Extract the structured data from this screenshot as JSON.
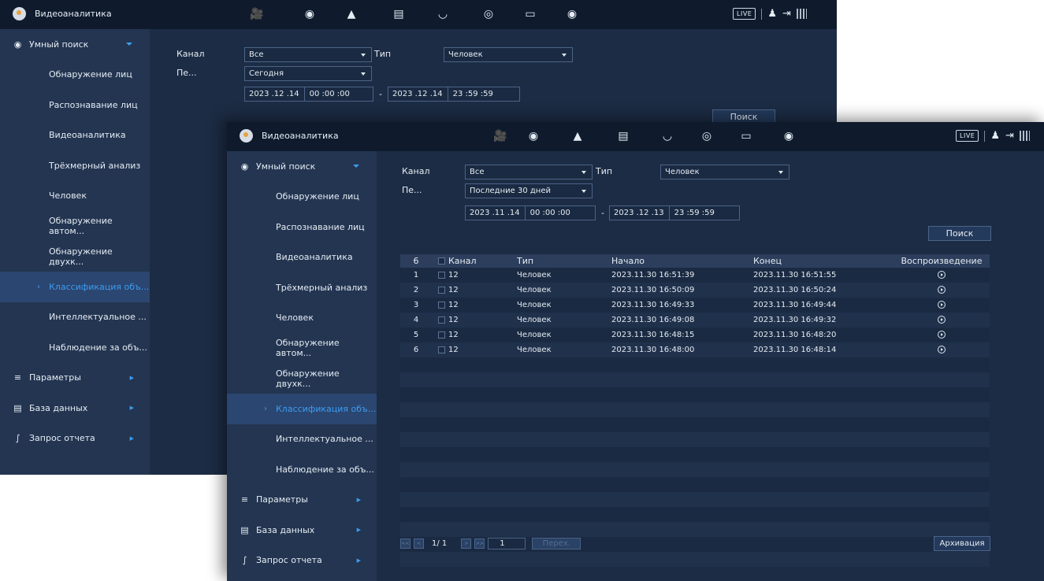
{
  "app": {
    "title": "Видеоаналитика",
    "live_badge": "LIVE",
    "toolbar_icons": [
      "film-icon",
      "face-icon",
      "alarm-icon",
      "storage-icon",
      "speed-icon",
      "target-icon",
      "monitor-icon",
      "speaker-icon"
    ],
    "accent_color": "#3c9cf0"
  },
  "sidebar": {
    "smart_search": "Умный поиск",
    "sub_items": [
      "Обнаружение лиц",
      "Распознавание лиц",
      "Видеоаналитика",
      "Трёхмерный анализ",
      "Человек",
      "Обнаружение автом...",
      "Обнаружение двухк...",
      "Классификация объ...",
      "Интеллектуальное ...",
      "Наблюдение за объ..."
    ],
    "active_index": 7,
    "parameters": "Параметры",
    "database": "База данных",
    "report": "Запрос отчета"
  },
  "back_window": {
    "channel_label": "Канал",
    "channel_value": "Все",
    "type_label": "Тип",
    "type_value": "Человек",
    "period_label": "Пе...",
    "period_value": "Сегодня",
    "start_date": "2023 .12 .14",
    "start_time": "00 :00 :00",
    "end_date": "2023 .12 .14",
    "end_time": "23 :59 :59",
    "search_button": "Поиск",
    "dash": "-"
  },
  "front_window": {
    "channel_label": "Канал",
    "channel_value": "Все",
    "type_label": "Тип",
    "type_value": "Человек",
    "period_label": "Пе...",
    "period_value": "Последние 30 дней",
    "start_date": "2023 .11 .14",
    "start_time": "00 :00 :00",
    "end_date": "2023 .12 .13",
    "end_time": "23 :59 :59",
    "search_button": "Поиск",
    "dash": "-",
    "table": {
      "count": "6",
      "headers": [
        "Канал",
        "Тип",
        "Начало",
        "Конец",
        "Воспроизведение"
      ],
      "rows": [
        {
          "no": "1",
          "channel": "12",
          "type": "Человек",
          "start": "2023.11.30 16:51:39",
          "end": "2023.11.30 16:51:55"
        },
        {
          "no": "2",
          "channel": "12",
          "type": "Человек",
          "start": "2023.11.30 16:50:09",
          "end": "2023.11.30 16:50:24"
        },
        {
          "no": "3",
          "channel": "12",
          "type": "Человек",
          "start": "2023.11.30 16:49:33",
          "end": "2023.11.30 16:49:44"
        },
        {
          "no": "4",
          "channel": "12",
          "type": "Человек",
          "start": "2023.11.30 16:49:08",
          "end": "2023.11.30 16:49:32"
        },
        {
          "no": "5",
          "channel": "12",
          "type": "Человек",
          "start": "2023.11.30 16:48:15",
          "end": "2023.11.30 16:48:20"
        },
        {
          "no": "6",
          "channel": "12",
          "type": "Человек",
          "start": "2023.11.30 16:48:00",
          "end": "2023.11.30 16:48:14"
        }
      ]
    },
    "pager": {
      "page_text": "1/ 1",
      "page_input": "1",
      "go_button": "Перех.",
      "first": "<<",
      "prev": "<",
      "next": ">",
      "last": ">>"
    },
    "archive_button": "Архивация"
  }
}
